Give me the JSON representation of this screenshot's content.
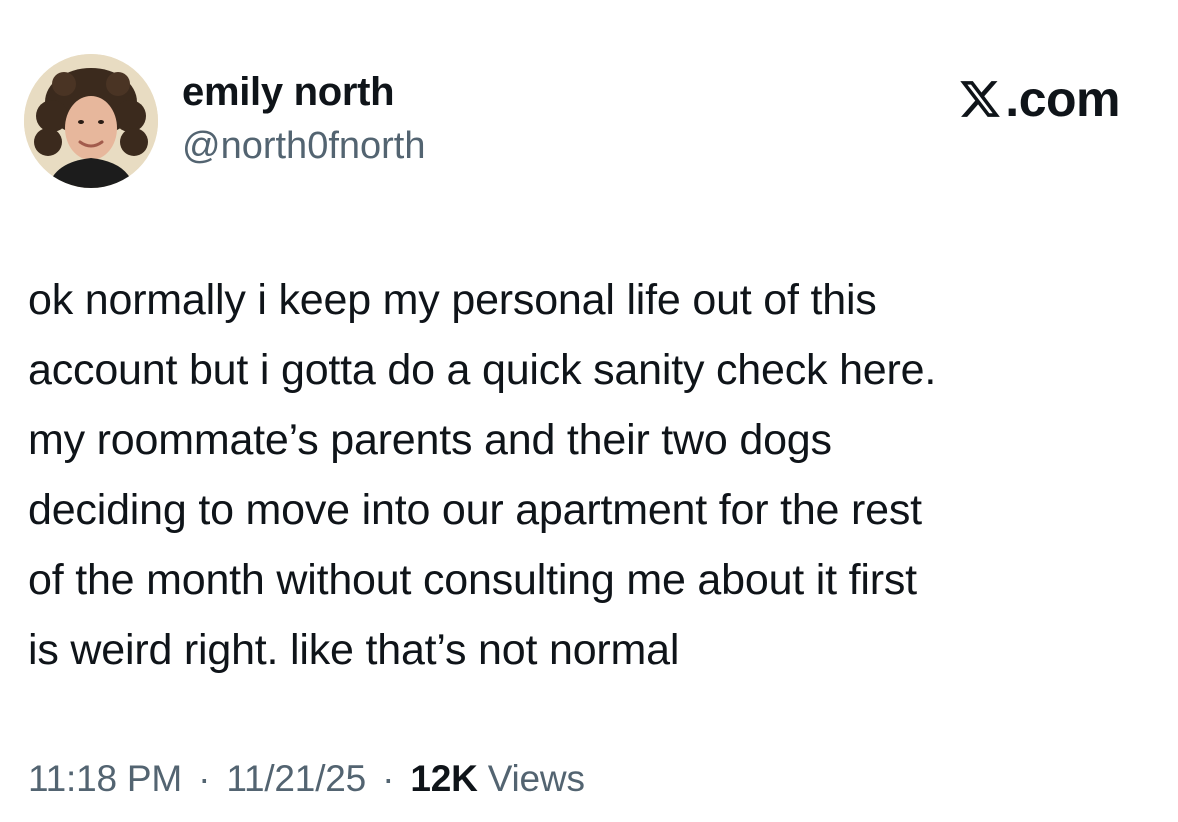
{
  "author": {
    "display_name": "emily north",
    "handle": "@north0fnorth"
  },
  "brand": {
    "logo_text": ".com",
    "logo_icon": "x-logo-icon"
  },
  "tweet": {
    "text": "ok normally i keep my personal life out of this\naccount but i gotta do a quick sanity check here.\nmy roommate’s parents and their two dogs\ndeciding to move into our apartment for the rest\nof the month without consulting me about it first\nis weird right. like that’s not normal",
    "time": "11:18 PM",
    "date": "11/21/25",
    "separator": "·",
    "views_count": "12K",
    "views_label": "Views"
  },
  "colors": {
    "text_primary": "#0f1419",
    "text_secondary": "#536471",
    "background": "#ffffff"
  }
}
